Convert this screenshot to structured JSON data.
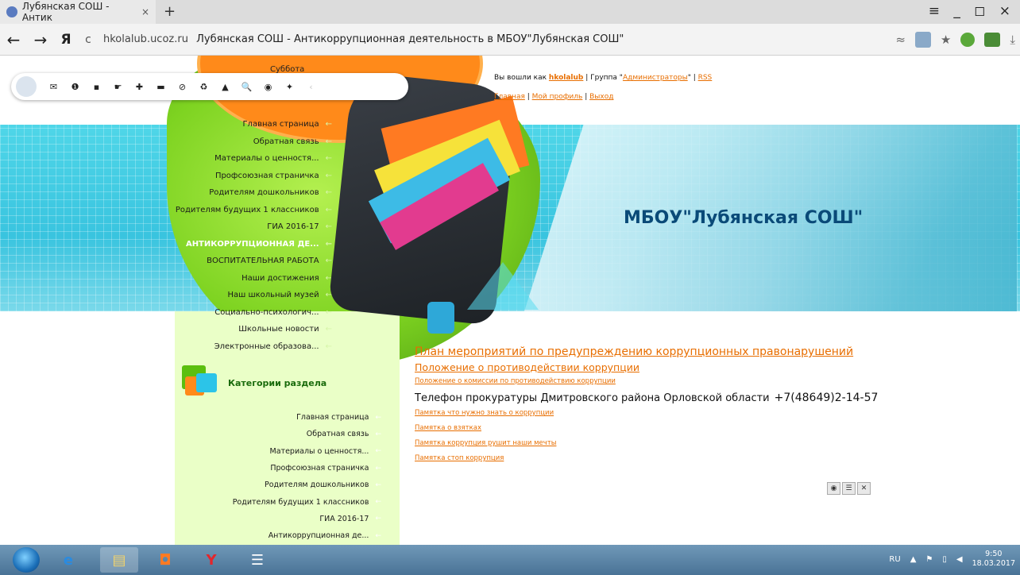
{
  "browser": {
    "tab_title": "Лубянская СОШ - Антик",
    "tab_close": "×",
    "new_tab": "+",
    "window_controls": "≡ _ ◻ ×",
    "back": "←",
    "forward": "→",
    "ya_button": "Я",
    "reload": "c",
    "url_domain": "hkolalub.ucoz.ru",
    "page_title": "Лубянская СОШ - Антикоррупционная деятельность в МБОУ\"Лубянская СОШ\"",
    "star": "★",
    "download": "⤓"
  },
  "header": {
    "date_label": "Суббота",
    "school_name": "МБОУ\"Лубянская СОШ\"",
    "logged_in_prefix": "Вы вошли как",
    "username": "hkolalub",
    "group_text": " | Группа \"",
    "group_name": "Администраторы",
    "group_close": "\" | ",
    "rss": "RSS",
    "link_home": "Главная",
    "sep": " | ",
    "link_profile": "Мой профиль",
    "link_logout": "Выход"
  },
  "main_menu": [
    {
      "label": "Главная страница",
      "active": false
    },
    {
      "label": "Обратная связь",
      "active": false
    },
    {
      "label": "Материалы о ценностя...",
      "active": false
    },
    {
      "label": "Профсоюзная страничка",
      "active": false
    },
    {
      "label": "Родителям дошкольников",
      "active": false
    },
    {
      "label": "Родителям будущих 1 классников",
      "active": false
    },
    {
      "label": "ГИА 2016-17",
      "active": false
    },
    {
      "label": "АНТИКОРРУПЦИОННАЯ ДЕ...",
      "active": true
    },
    {
      "label": "ВОСПИТАТЕЛЬНАЯ РАБОТА",
      "active": false
    },
    {
      "label": "Наши достижения",
      "active": false
    },
    {
      "label": "Наш школьный музей",
      "active": false
    },
    {
      "label": "Социально-психологич...",
      "active": false
    },
    {
      "label": "Школьные новости",
      "active": false
    },
    {
      "label": "Электронные образова...",
      "active": false
    }
  ],
  "menu_arrow": "←",
  "categories": {
    "title": "Категории раздела",
    "items": [
      "Главная страница",
      "Обратная связь",
      "Материалы о ценностя...",
      "Профсоюзная страничка",
      "Родителям дошкольников",
      "Родителям будущих 1 классников",
      "ГИА 2016-17",
      "Антикоррупционная де..."
    ]
  },
  "content": {
    "link_plan": "План мероприятий по предупреждению коррупционных правонарушений",
    "link_regulation": "Положение о противодействии коррупции",
    "link_commission": "Положение о комиссии по противодействию коррупции",
    "phone_text": "Телефон прокуратуры Дмитровского района Орловской области",
    "phone_number": "+7(48649)2-14-57",
    "memo_links": [
      "Памятка что нужно знать о коррупции",
      "Памятка о взятках",
      "Памятка коррупция рушит наши мечты",
      "Памятка стоп коррупция"
    ]
  },
  "mini_tools": [
    "◉",
    "☰",
    "✕"
  ],
  "toolbar_icons": [
    "mail-icon",
    "info-icon",
    "file-icon",
    "chat-icon",
    "add-icon",
    "folder-icon",
    "block-icon",
    "trash-icon",
    "bell-icon",
    "search-icon",
    "eye-icon",
    "tools-icon",
    "collapse-icon"
  ],
  "toolbar_glyphs": [
    "✉",
    "❶",
    "▪",
    "☛",
    "✚",
    "▬",
    "⊘",
    "♻",
    "▲",
    "🔍",
    "◉",
    "✦",
    "‹"
  ],
  "taskbar": {
    "lang": "RU",
    "time": "9:50",
    "date": "18.03.2017"
  }
}
